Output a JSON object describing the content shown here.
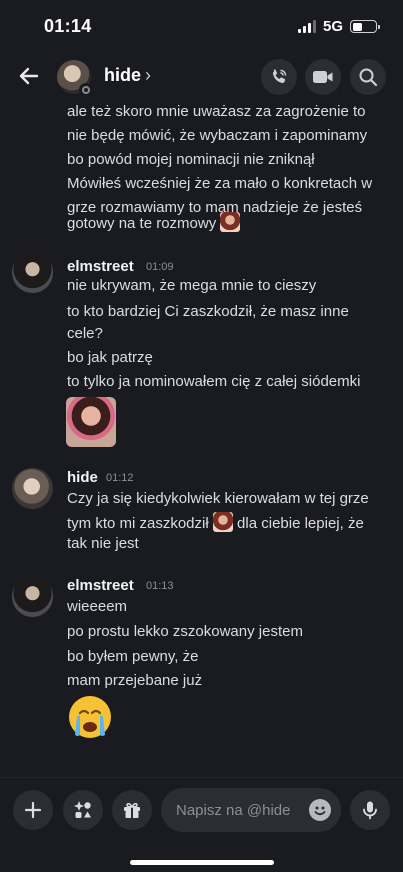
{
  "status": {
    "time": "01:14",
    "network": "5G"
  },
  "header": {
    "name": "hide",
    "chevron": "›"
  },
  "messages": {
    "cont": [
      "ale też skoro mnie uważasz za zagrożenie to",
      "nie będę mówić, że wybaczam i zapominamy",
      "bo powód mojej nominacji nie zniknął",
      "Mówiłeś wcześniej że za mało o konkretach w",
      "grze rozmawiamy to mam nadzieje że jesteś",
      "gotowy na te rozmowy"
    ],
    "groups": [
      {
        "author": "elmstreet",
        "time": "01:09",
        "lines": [
          "nie ukrywam, że mega mnie to cieszy",
          "to kto bardziej Ci zaszkodził, że masz inne",
          "cele?",
          "bo jak patrzę",
          "to tylko ja nominowałem cię z całej siódemki"
        ]
      },
      {
        "author": "hide",
        "time": "01:12",
        "lines": [
          "Czy ja się kiedykolwiek kierowałam w tej grze",
          "tym kto mi zaszkodził",
          "dla ciebie lepiej, że",
          "tak nie jest"
        ]
      },
      {
        "author": "elmstreet",
        "time": "01:13",
        "lines": [
          "wieeeem",
          "po prostu lekko zszokowany jestem",
          "bo byłem pewny, że",
          "mam przejebane już"
        ]
      }
    ]
  },
  "composer": {
    "placeholder": "Napisz na @hide"
  },
  "icons": {
    "back": "arrow-left-icon",
    "call": "phone-icon",
    "video": "video-camera-icon",
    "search": "search-icon",
    "add": "plus-icon",
    "apps": "apps-icon",
    "gift": "gift-icon",
    "emoji": "smiley-icon",
    "mic": "microphone-icon"
  },
  "colors": {
    "background": "#1a1b20",
    "surface": "#2b2d33",
    "text": "#dcdde2",
    "muted": "#8e8f96"
  }
}
